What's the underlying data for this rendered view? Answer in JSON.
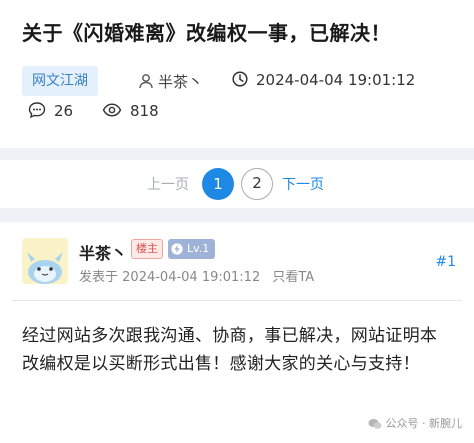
{
  "thread": {
    "title": "关于《闪婚难离》改编权一事，已解决！",
    "tag": "网文江湖",
    "author": "半茶丶",
    "time": "2024-04-04 19:01:12",
    "comments": "26",
    "views": "818"
  },
  "pagination": {
    "prev_label": "上一页",
    "pages": [
      "1",
      "2"
    ],
    "current": "1",
    "next_label": "下一页"
  },
  "post": {
    "poster_name": "半茶丶",
    "owner_badge": "楼主",
    "level_badge": "Lv.1",
    "posted_prefix": "发表于",
    "posted_time": "2024-04-04 19:01:12",
    "only_author_link": "只看TA",
    "floor": "#1",
    "content": "经过网站多次跟我沟通、协商，事已解决，网站证明本改编权是以买断形式出售！感谢大家的关心与支持！"
  },
  "watermark": "公众号 · 新腕儿",
  "colors": {
    "accent": "#1e88e5",
    "tag_bg": "#e4f0fb",
    "band": "#eef1f6",
    "owner_badge": "#d9534f",
    "level_badge": "#9fb3d8"
  },
  "icons": [
    "user-icon",
    "clock-icon",
    "comment-icon",
    "eye-icon",
    "lightning-icon",
    "wechat-icon"
  ]
}
